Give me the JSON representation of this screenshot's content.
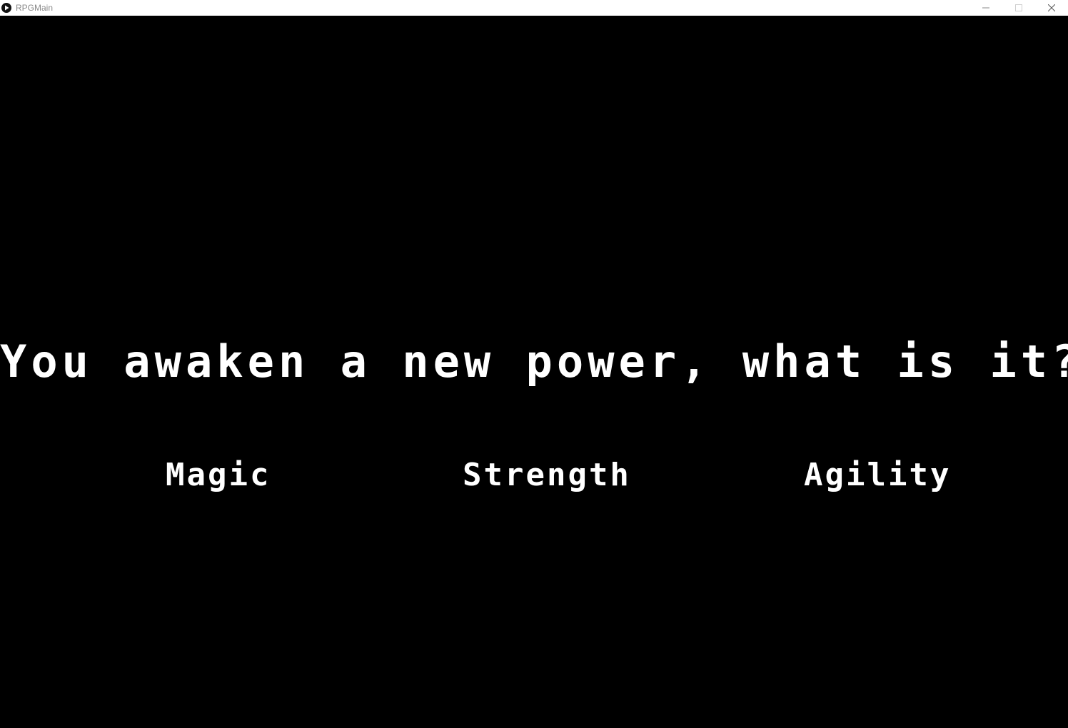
{
  "window": {
    "title": "RPGMain",
    "icon": "play-icon"
  },
  "game": {
    "prompt": "You awaken a new power, what is it?",
    "options": [
      {
        "label": "Magic"
      },
      {
        "label": "Strength"
      },
      {
        "label": "Agility"
      }
    ],
    "colors": {
      "background": "#000000",
      "text": "#ffffff"
    }
  }
}
